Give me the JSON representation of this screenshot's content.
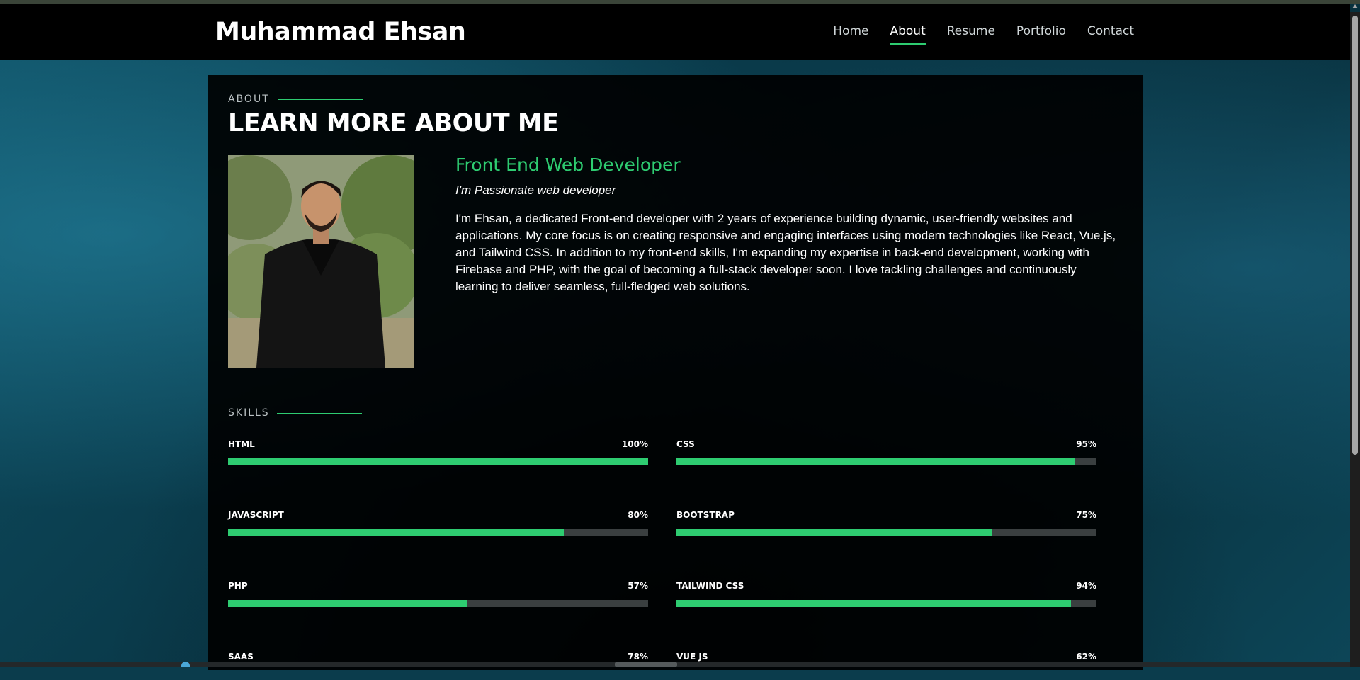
{
  "header": {
    "brand": "Muhammad Ehsan",
    "nav": [
      "Home",
      "About",
      "Resume",
      "Portfolio",
      "Contact"
    ],
    "active_nav": "About"
  },
  "about": {
    "section_label": "ABOUT",
    "title": "LEARN MORE ABOUT ME",
    "role": "Front End Web Developer",
    "tagline": "I'm Passionate web developer",
    "bio": "I'm Ehsan, a dedicated Front-end developer with 2 years of experience building dynamic, user-friendly websites and applications. My core focus is on creating responsive and engaging interfaces using modern technologies like React, Vue.js, and Tailwind CSS. In addition to my front-end skills, I'm expanding my expertise in back-end development, working with Firebase and PHP, with the goal of becoming a full-stack developer soon. I love tackling challenges and continuously learning to deliver seamless, full-fledged web solutions."
  },
  "skills": {
    "section_label": "SKILLS",
    "items": [
      {
        "name": "HTML",
        "percent_label": "100%",
        "value": 100
      },
      {
        "name": "CSS",
        "percent_label": "95%",
        "value": 95
      },
      {
        "name": "JAVASCRIPT",
        "percent_label": "80%",
        "value": 80
      },
      {
        "name": "BOOTSTRAP",
        "percent_label": "75%",
        "value": 75
      },
      {
        "name": "PHP",
        "percent_label": "57%",
        "value": 57
      },
      {
        "name": "TAILWIND CSS",
        "percent_label": "94%",
        "value": 94
      },
      {
        "name": "SAAS",
        "percent_label": "78%",
        "value": 78
      },
      {
        "name": "VUE JS",
        "percent_label": "62%",
        "value": 62
      }
    ]
  },
  "colors": {
    "accent": "#2ecc71",
    "header_bg": "#000000",
    "panel_bg": "#000000",
    "bar_track": "#3a3f40"
  }
}
